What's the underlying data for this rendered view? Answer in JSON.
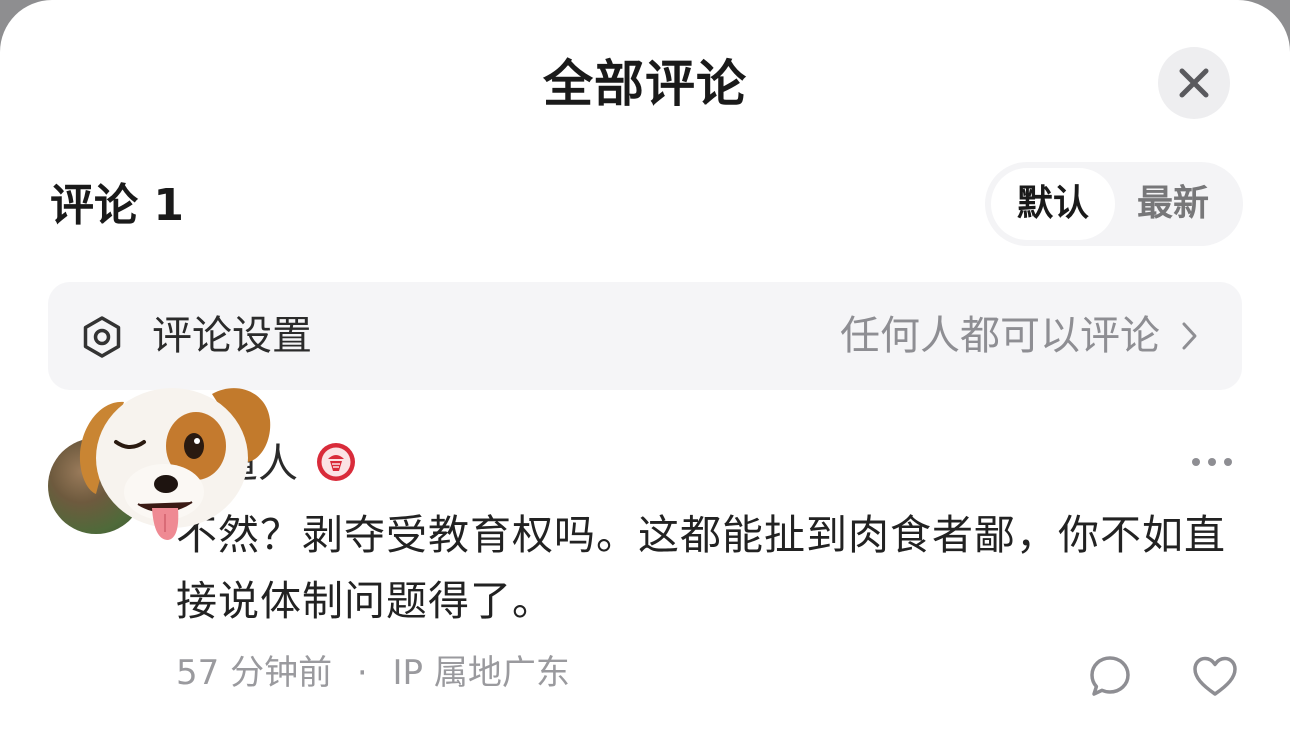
{
  "header": {
    "title": "全部评论",
    "close_icon": "close-icon"
  },
  "comments_section": {
    "count_label": "评论 1",
    "sort": {
      "options": [
        "默认",
        "最新"
      ],
      "selected": "默认"
    }
  },
  "settings": {
    "icon": "hexagon-settings-icon",
    "label": "评论设置",
    "value": "任何人都可以评论",
    "chevron": "chevron-right-icon"
  },
  "comment": {
    "username": "道人",
    "badge_icon": "level-badge-icon",
    "text": "不然？剥夺受教育权吗。这都能扯到肉食者鄙，你不如直接说体制问题得了。",
    "time": "57 分钟前",
    "separator": "·",
    "location": "IP 属地广东",
    "more_icon": "more-icon",
    "reply_icon": "reply-icon",
    "like_icon": "heart-icon"
  },
  "colors": {
    "accent_badge": "#d92b3a",
    "muted_text": "#8e8e93"
  }
}
